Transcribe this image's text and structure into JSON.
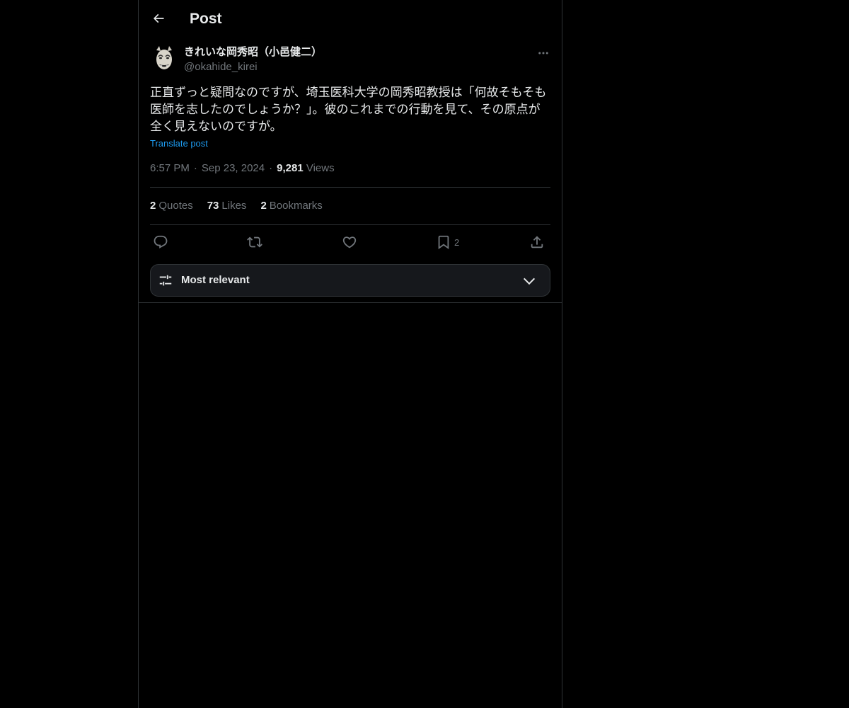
{
  "header": {
    "title": "Post",
    "back_icon": "arrow-left-icon"
  },
  "author": {
    "display_name": "きれいな岡秀昭（小邑健二）",
    "handle": "@okahide_kirei",
    "avatar_icon": "noh-mask-avatar"
  },
  "post": {
    "text": "正直ずっと疑問なのですが、埼玉医科大学の岡秀昭教授は「何故そもそも\n医師を志したのでしょうか？」。彼のこれまでの行動を見て、その原点が\n全く見えないのですが。",
    "translate_label": "Translate post",
    "time": "6:57 PM",
    "date": "Sep 23, 2024",
    "views_count": "9,281",
    "views_label": "Views",
    "separator": "·"
  },
  "stats": {
    "quotes_count": "2",
    "quotes_label": "Quotes",
    "likes_count": "73",
    "likes_label": "Likes",
    "bookmarks_count": "2",
    "bookmarks_label": "Bookmarks"
  },
  "actions": {
    "reply_icon": "reply-icon",
    "repost_icon": "repost-icon",
    "like_icon": "heart-icon",
    "bookmark_icon": "bookmark-icon",
    "bookmark_count": "2",
    "share_icon": "share-icon"
  },
  "sort": {
    "label": "Most relevant",
    "icon": "sliders-icon",
    "chevron": "chevron-down-icon"
  },
  "colors": {
    "background": "#000000",
    "text": "#e7e9ea",
    "muted": "#71767b",
    "link": "#1d9bf0",
    "border": "#2f3336"
  }
}
